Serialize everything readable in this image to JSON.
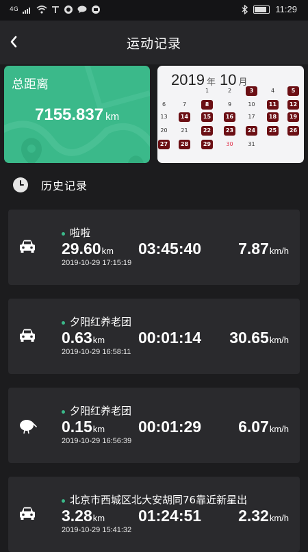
{
  "status_bar": {
    "signal": "4G",
    "time": "11:29"
  },
  "nav": {
    "title": "运动记录",
    "back_icon": "chevron-left-icon"
  },
  "summary": {
    "label": "总距离",
    "distance": "7155.837",
    "unit": "km",
    "accent": "#3bb98a"
  },
  "calendar": {
    "year": "2019",
    "year_unit": "年",
    "month": "10",
    "month_unit": "月",
    "highlight_color": "#6b0f14",
    "today_color": "#e0304a",
    "rows": [
      [
        "",
        "",
        "1",
        "2",
        "3",
        "4",
        "5"
      ],
      [
        "6",
        "7",
        "8",
        "9",
        "10",
        "11",
        "12"
      ],
      [
        "13",
        "14",
        "15",
        "16",
        "17",
        "18",
        "19"
      ],
      [
        "20",
        "21",
        "22",
        "23",
        "24",
        "25",
        "26"
      ],
      [
        "27",
        "28",
        "29",
        "30",
        "31",
        "",
        ""
      ]
    ],
    "recorded_days": [
      "3",
      "5",
      "8",
      "11",
      "12",
      "14",
      "15",
      "16",
      "18",
      "19",
      "22",
      "23",
      "24",
      "25",
      "26",
      "27",
      "28",
      "29"
    ],
    "today": "30"
  },
  "history": {
    "title": "历史记录",
    "icon": "clock-icon"
  },
  "records": [
    {
      "icon": "car-icon",
      "title": "啦啦",
      "distance": "29.60",
      "distance_unit": "km",
      "duration": "03:45:40",
      "speed": "7.87",
      "speed_unit": "km/h",
      "datetime": "2019-10-29 17:15:19"
    },
    {
      "icon": "car-icon",
      "title": "夕阳红养老团",
      "distance": "0.63",
      "distance_unit": "km",
      "duration": "00:01:14",
      "speed": "30.65",
      "speed_unit": "km/h",
      "datetime": "2019-10-29 16:58:11"
    },
    {
      "icon": "kiwi-bird-icon",
      "title": "夕阳红养老团",
      "distance": "0.15",
      "distance_unit": "km",
      "duration": "00:01:29",
      "speed": "6.07",
      "speed_unit": "km/h",
      "datetime": "2019-10-29 16:56:39"
    },
    {
      "icon": "car-icon",
      "title": "北京市西城区北大安胡同76靠近新星出",
      "distance": "3.28",
      "distance_unit": "km",
      "duration": "01:24:51",
      "speed": "2.32",
      "speed_unit": "km/h",
      "datetime": "2019-10-29 15:41:32"
    }
  ]
}
